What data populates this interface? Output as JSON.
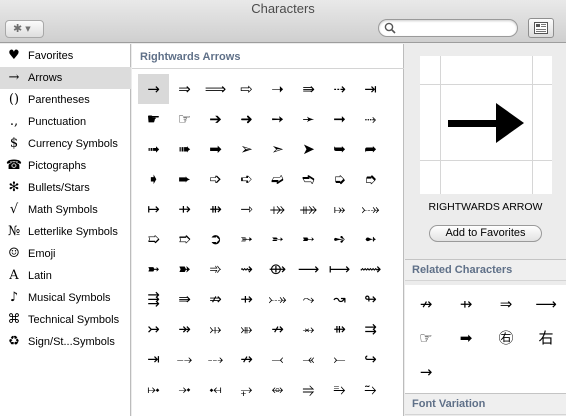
{
  "window": {
    "title": "Characters"
  },
  "toolbar": {
    "search_placeholder": "",
    "search_value": ""
  },
  "sidebar": {
    "items": [
      {
        "icon": "♥",
        "label": "Favorites"
      },
      {
        "icon": "→",
        "label": "Arrows",
        "selected": true
      },
      {
        "icon": "()",
        "label": "Parentheses"
      },
      {
        "icon": ".,",
        "label": "Punctuation"
      },
      {
        "icon": "$",
        "label": "Currency Symbols"
      },
      {
        "icon": "☎",
        "label": "Pictographs"
      },
      {
        "icon": "✻",
        "label": "Bullets/Stars"
      },
      {
        "icon": "√",
        "label": "Math Symbols"
      },
      {
        "icon": "№",
        "label": "Letterlike Symbols"
      },
      {
        "icon": "☺",
        "label": "Emoji"
      },
      {
        "icon": "A",
        "label": "Latin"
      },
      {
        "icon": "♪",
        "label": "Musical Symbols"
      },
      {
        "icon": "⌘",
        "label": "Technical Symbols"
      },
      {
        "icon": "♻",
        "label": "Sign/St...Symbols"
      }
    ]
  },
  "grid": {
    "header": "Rightwards Arrows",
    "selected_index": 0,
    "rows": [
      [
        "→",
        "⇒",
        "⟹",
        "⇨",
        "➝",
        "⇛",
        "⇢",
        "⇥"
      ],
      [
        "☛",
        "☞",
        "➔",
        "➜",
        "➙",
        "➛",
        "➞",
        "⤑"
      ],
      [
        "➟",
        "➠",
        "➡",
        "➢",
        "➣",
        "➤",
        "➥",
        "➦"
      ],
      [
        "➧",
        "➨",
        "➩",
        "➪",
        "➫",
        "➬",
        "➭",
        "➮"
      ],
      [
        "↦",
        "⇸",
        "⇻",
        "⇾",
        "⤀",
        "⤁",
        "⤅",
        "⤐"
      ],
      [
        "➯",
        "➱",
        "➲",
        "➳",
        "➵",
        "➸",
        "➺",
        "➻"
      ],
      [
        "➼",
        "➽",
        "➾",
        "⇝",
        "⟴",
        "⟶",
        "⟼",
        "⟿"
      ],
      [
        "⇶",
        "⇛",
        "⇏",
        "⇸",
        "⤐",
        "⤳",
        "↝",
        "↬"
      ],
      [
        "↣",
        "↠",
        "⤔",
        "⤕",
        "↛",
        "⥇",
        "⇻",
        "⇉"
      ],
      [
        "⇥",
        "⤍",
        "⤏",
        "↛",
        "⤙",
        "⤛",
        "⤚",
        "↪"
      ],
      [
        "⤠",
        "⤞",
        "⤟",
        "⥅",
        "⥈",
        "⥤",
        "⥱",
        "⥲"
      ]
    ]
  },
  "detail": {
    "preview_char": "→",
    "char_name": "RIGHTWARDS ARROW",
    "add_to_favorites_label": "Add to Favorites",
    "related_header": "Related Characters",
    "related": [
      "↛",
      "⇸",
      "⇒",
      "⟶",
      "☞",
      "➡",
      "㊨",
      "右",
      "→"
    ],
    "font_variation_header": "Font Variation"
  }
}
